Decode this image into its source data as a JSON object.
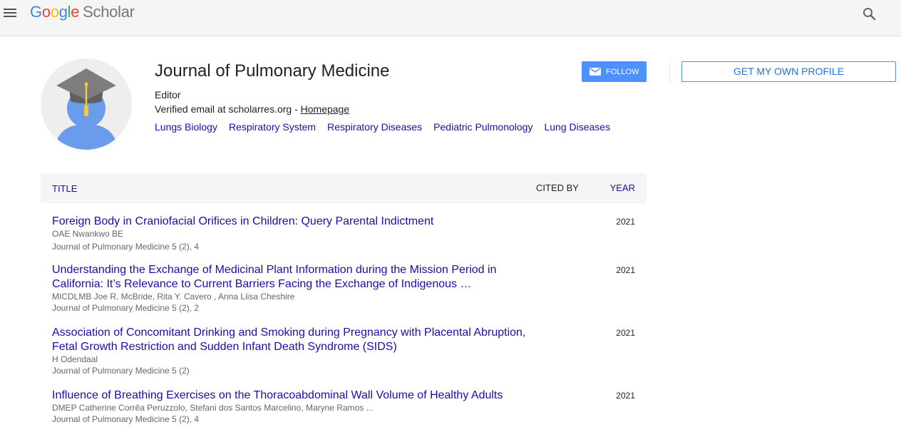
{
  "header": {
    "logo": {
      "g1": "G",
      "g2": "o",
      "g3": "o",
      "g4": "g",
      "g5": "l",
      "g6": "e",
      "product": "Scholar"
    }
  },
  "profile": {
    "name": "Journal of Pulmonary Medicine",
    "affiliation": "Editor",
    "verified_text": "Verified email at scholarres.org - ",
    "homepage_label": "Homepage",
    "interests": [
      "Lungs Biology",
      "Respiratory System",
      "Respiratory Diseases",
      "Pediatric Pulmonology",
      "Lung Diseases"
    ],
    "follow_label": "FOLLOW",
    "get_profile_label": "GET MY OWN PROFILE"
  },
  "table": {
    "headers": {
      "title": "TITLE",
      "cited_by": "CITED BY",
      "year": "YEAR"
    },
    "rows": [
      {
        "title": "Foreign Body in Craniofacial Orifices in Children: Query Parental Indictment",
        "authors": "OAE Nwankwo BE",
        "venue": "Journal of Pulmonary Medicine 5 (2), 4",
        "year": "2021"
      },
      {
        "title": "Understanding the Exchange of Medicinal Plant Information during the Mission Period in California: It’s Relevance to Current Barriers Facing the Exchange of Indigenous …",
        "authors": "MICDLMB Joe R. McBride, Rita Y. Cavero , Anna Liisa Cheshire",
        "venue": "Journal of Pulmonary Medicine 5 (2), 2",
        "year": "2021"
      },
      {
        "title": "Association of Concomitant Drinking and Smoking during Pregnancy with Placental Abruption, Fetal Growth Restriction and Sudden Infant Death Syndrome (SIDS)",
        "authors": "H Odendaal",
        "venue": "Journal of Pulmonary Medicine 5 (2)",
        "year": "2021"
      },
      {
        "title": "Influence of Breathing Exercises on the Thoracoabdominal Wall Volume of Healthy Adults",
        "authors": "DMEP Catherine Corrêa Peruzzolo, Stefani dos Santos Marcelino, Maryne Ramos ...",
        "venue": "Journal of Pulmonary Medicine 5 (2), 4",
        "year": "2021"
      }
    ]
  },
  "icons": {
    "menu": "menu-icon",
    "search": "search-icon",
    "mail": "mail-icon",
    "avatar": "graduate-avatar-icon"
  },
  "colors": {
    "link": "#1a0dab",
    "accent": "#4d90fe",
    "header_bg": "#f5f5f5"
  }
}
